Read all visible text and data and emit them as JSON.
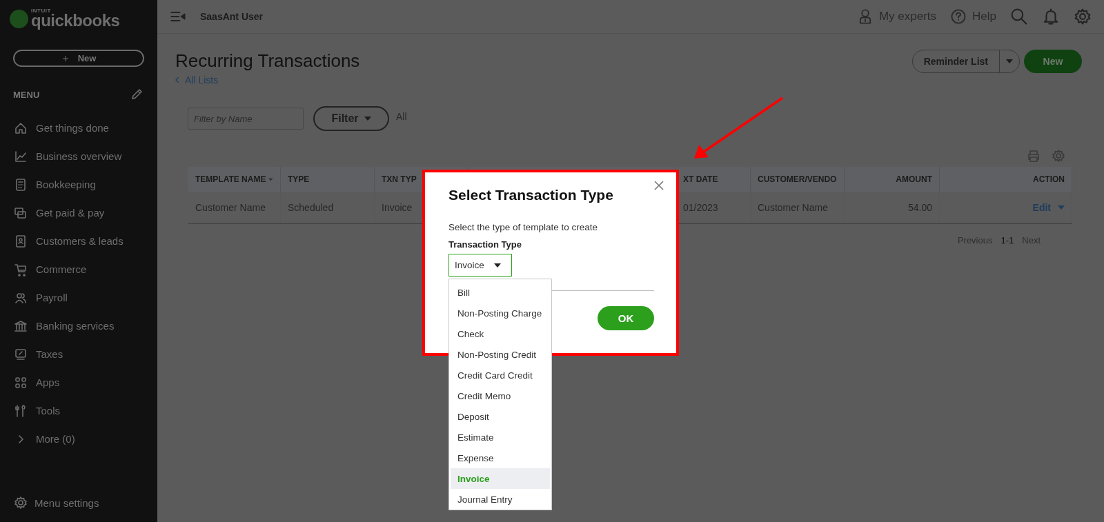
{
  "logo": {
    "maker": "INTUIT",
    "brand": "quickbooks"
  },
  "sidebar": {
    "new_button": "New",
    "menu_label": "MENU",
    "items": [
      {
        "label": "Get things done"
      },
      {
        "label": "Business overview"
      },
      {
        "label": "Bookkeeping"
      },
      {
        "label": "Get paid & pay"
      },
      {
        "label": "Customers & leads"
      },
      {
        "label": "Commerce"
      },
      {
        "label": "Payroll"
      },
      {
        "label": "Banking services"
      },
      {
        "label": "Taxes"
      },
      {
        "label": "Apps"
      },
      {
        "label": "Tools"
      },
      {
        "label": "More (0)"
      }
    ],
    "settings": "Menu settings"
  },
  "top_bar": {
    "company": "SaasAnt User",
    "experts": "My experts",
    "help": "Help"
  },
  "page": {
    "title": "Recurring Transactions",
    "back_link": "All Lists",
    "reminder_button": "Reminder List",
    "new_button": "New"
  },
  "filter": {
    "placeholder": "Filter by Name",
    "button": "Filter",
    "value": "All"
  },
  "table": {
    "columns": [
      "TEMPLATE NAME",
      "TYPE",
      "TXN TYP",
      "XT DATE",
      "CUSTOMER/VENDO",
      "AMOUNT",
      "ACTION"
    ],
    "rows": [
      {
        "cells": [
          "Customer Name",
          "Scheduled",
          "Invoice",
          "01/2023",
          "Customer Name",
          "54.00"
        ],
        "action": "Edit"
      }
    ]
  },
  "pagination": [
    {
      "label": "Previous",
      "disabled": true
    },
    {
      "label": "1-1",
      "disabled": false
    },
    {
      "label": "Next",
      "disabled": true
    }
  ],
  "dialog": {
    "title": "Select Transaction Type",
    "description": "Select the type of template to create",
    "field_label": "Transaction Type",
    "value": "Invoice",
    "ok": "OK",
    "options": [
      {
        "label": "Bill",
        "selected": false
      },
      {
        "label": "Non-Posting Charge",
        "selected": false
      },
      {
        "label": "Check",
        "selected": false
      },
      {
        "label": "Non-Posting Credit",
        "selected": false
      },
      {
        "label": "Credit Card Credit",
        "selected": false
      },
      {
        "label": "Credit Memo",
        "selected": false
      },
      {
        "label": "Deposit",
        "selected": false
      },
      {
        "label": "Estimate",
        "selected": false
      },
      {
        "label": "Expense",
        "selected": false
      },
      {
        "label": "Invoice",
        "selected": true
      },
      {
        "label": "Journal Entry",
        "selected": false
      }
    ]
  }
}
